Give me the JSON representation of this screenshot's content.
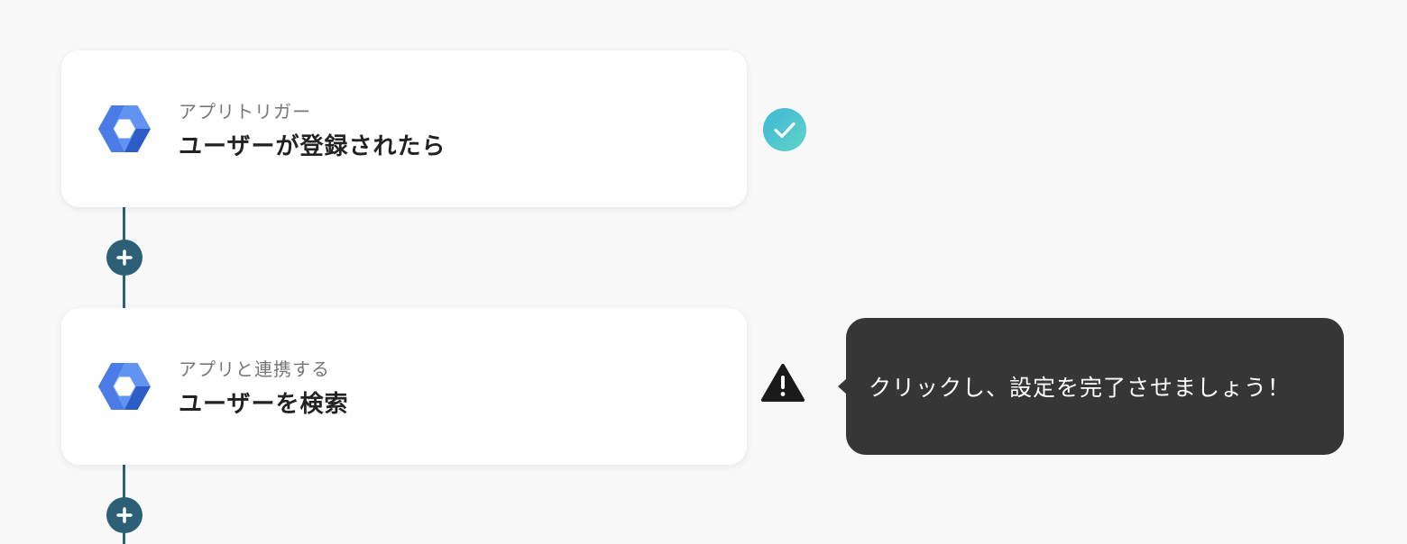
{
  "colors": {
    "background": "#f8f8f8",
    "connector": "#2d5f76",
    "success": "#45c3d4",
    "warning": "#1a1a1a",
    "tooltip_bg": "#363636",
    "app_blue_light": "#6293f3",
    "app_blue_dark": "#2c5cc5"
  },
  "flow": {
    "steps": [
      {
        "icon": "google-workspace-hexagon-icon",
        "subtitle": "アプリトリガー",
        "title": "ユーザーが登録されたら",
        "status": "complete",
        "status_icon": "check-circle-icon"
      },
      {
        "icon": "google-workspace-hexagon-icon",
        "subtitle": "アプリと連携する",
        "title": "ユーザーを検索",
        "status": "incomplete",
        "status_icon": "warning-triangle-icon"
      }
    ],
    "add_step_icon": "plus-icon"
  },
  "tooltip": {
    "text": "クリックし、設定を完了させましょう！"
  }
}
